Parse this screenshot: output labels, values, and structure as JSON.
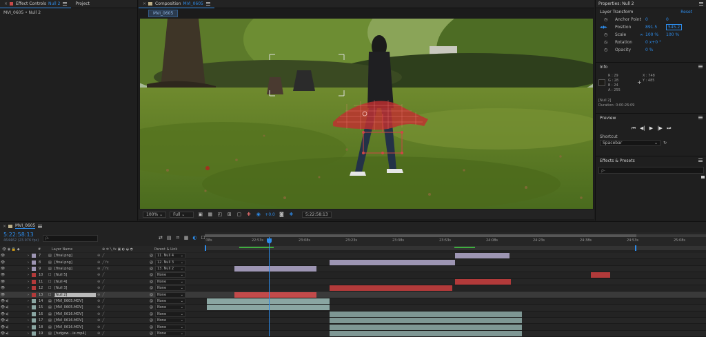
{
  "colors": {
    "accent": "#2d8ceb",
    "bg": "#1d1d1d",
    "panel": "#232323",
    "red_bar": "#b23a3a",
    "lavender_bar": "#9d95b3",
    "teal_bar": "#8aa6a2"
  },
  "left_panel": {
    "tab_effect_controls": "Effect Controls",
    "tab_effect_controls_target": "Null 2",
    "tab_project": "Project",
    "breadcrumb": "MVI_0605 • Null 2"
  },
  "comp_panel": {
    "tab_label": "Composition",
    "tab_target": "MVI_0605",
    "comp_chip": "MVI_0605",
    "zoom": "100%",
    "resolution": "Full",
    "exposure": "+0.0",
    "timecode": "5:22:58:13"
  },
  "properties": {
    "title": "Properties: Null 2",
    "section": "Layer Transform",
    "reset": "Reset",
    "rows": [
      {
        "label": "Anchor Point",
        "v1": "0",
        "v2": "0",
        "icon": "stopwatch-icon"
      },
      {
        "label": "Position",
        "v1": "891.5",
        "v2": "545.2",
        "icon": "stopwatch-icon"
      },
      {
        "label": "Scale",
        "v1": "100 %",
        "v2": "100 %",
        "icon": "stopwatch-icon"
      },
      {
        "label": "Rotation",
        "v1": "0 x+0 °",
        "v2": "",
        "icon": "stopwatch-icon"
      },
      {
        "label": "Opacity",
        "v1": "0 %",
        "v2": "",
        "icon": "stopwatch-icon"
      }
    ]
  },
  "info": {
    "title": "Info",
    "r": "R : 29",
    "g": "G : 28",
    "b": "B : 24",
    "a": "A : 255",
    "x": "X : 748",
    "y": "Y : 485",
    "layer": "[Null 2]",
    "duration": "Duration: 0:00:26:09"
  },
  "preview": {
    "title": "Preview",
    "shortcut_label": "Shortcut",
    "shortcut_value": "Spacebar"
  },
  "effects_presets": {
    "title": "Effects & Presets",
    "search_placeholder": "ρ-"
  },
  "timeline": {
    "tab": "MVI_0605",
    "timecode": "5:22:58:13",
    "fps_info": "464462 (23.976 fps)",
    "search_placeholder": "ρ-",
    "col_hash": "#",
    "col_layer_name": "Layer Name",
    "col_parent": "Parent & Link",
    "ruler_ticks": [
      ":38s",
      "22:53s",
      "23:08s",
      "23:23s",
      "23:38s",
      "23:53s",
      "24:08s",
      "24:23s",
      "24:38s",
      "24:53s",
      "25:08s"
    ],
    "layers": [
      {
        "num": "7",
        "name": "[final.png]",
        "parent": "11. Null 4",
        "color": "#9d95b3",
        "kind": "image"
      },
      {
        "num": "8",
        "name": "[final.png]",
        "parent": "12. Null 3",
        "color": "#9d95b3",
        "kind": "image"
      },
      {
        "num": "9",
        "name": "[final.png]",
        "parent": "13. Null 2",
        "color": "#9d95b3",
        "kind": "image"
      },
      {
        "num": "10",
        "name": "[Null 5]",
        "parent": "None",
        "color": "#b23a3a",
        "kind": "null"
      },
      {
        "num": "11",
        "name": "[Null 4]",
        "parent": "None",
        "color": "#b23a3a",
        "kind": "null"
      },
      {
        "num": "12",
        "name": "[Null 3]",
        "parent": "None",
        "color": "#b23a3a",
        "kind": "null"
      },
      {
        "num": "13",
        "name": "[Null 2]",
        "parent": "None",
        "color": "#b23a3a",
        "kind": "null"
      },
      {
        "num": "14",
        "name": "[MVI_0605.MOV]",
        "parent": "None",
        "color": "#8aa6a2",
        "kind": "video"
      },
      {
        "num": "15",
        "name": "[MVI_0605.MOV]",
        "parent": "None",
        "color": "#8aa6a2",
        "kind": "video"
      },
      {
        "num": "16",
        "name": "[MVI_0616.MOV]",
        "parent": "None",
        "color": "#8aa6a2",
        "kind": "video"
      },
      {
        "num": "17",
        "name": "[MVI_0616.MOV]",
        "parent": "None",
        "color": "#8aa6a2",
        "kind": "video"
      },
      {
        "num": "18",
        "name": "[MVI_0616.MOV]",
        "parent": "None",
        "color": "#8aa6a2",
        "kind": "video"
      },
      {
        "num": "19",
        "name": "[fudgew....ie.mp4]",
        "parent": "None",
        "color": "#8aa6a2",
        "kind": "video"
      }
    ]
  }
}
